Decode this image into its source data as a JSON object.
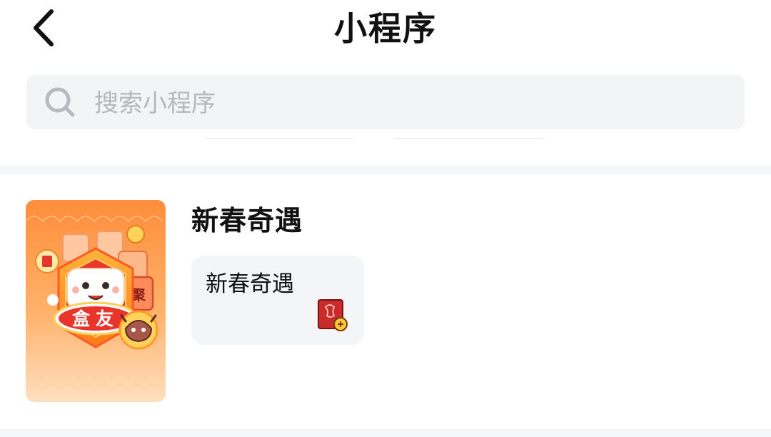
{
  "header": {
    "title": "小程序"
  },
  "search": {
    "placeholder": "搜索小程序"
  },
  "result": {
    "title": "新春奇遇",
    "thumbnail_text": "盒友",
    "thumbnail_badge": "聚",
    "card": {
      "title": "新春奇遇"
    }
  },
  "colors": {
    "search_bg": "#f3f4f6",
    "divider": "#f5f6f7",
    "thumb_orange": "#ff8a2a",
    "badge_red": "#e6352b"
  }
}
